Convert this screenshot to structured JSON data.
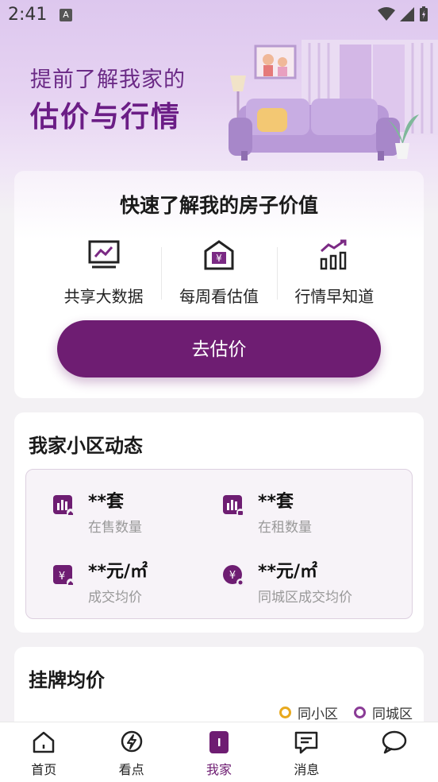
{
  "status_bar": {
    "time": "2:41",
    "badge": "A"
  },
  "hero": {
    "line1": "提前了解我家的",
    "line2": "估价与行情"
  },
  "valuation_card": {
    "title": "快速了解我的房子价值",
    "features": [
      {
        "icon": "chart-monitor-icon",
        "label": "共享大数据"
      },
      {
        "icon": "price-tag-icon",
        "label": "每周看估值"
      },
      {
        "icon": "trend-bars-icon",
        "label": "行情早知道"
      }
    ],
    "cta_label": "去估价"
  },
  "community_card": {
    "title": "我家小区动态",
    "stats": [
      {
        "value": "**套",
        "label": "在售数量",
        "icon": "for-sale-icon"
      },
      {
        "value": "**套",
        "label": "在租数量",
        "icon": "for-rent-icon"
      },
      {
        "value": "**元/㎡",
        "label": "成交均价",
        "icon": "deal-price-icon"
      },
      {
        "value": "**元/㎡",
        "label": "同城区成交均价",
        "icon": "district-price-icon"
      }
    ]
  },
  "listing_card": {
    "title": "挂牌均价",
    "legend": [
      {
        "label": "同小区",
        "color": "#e8a91e"
      },
      {
        "label": "同城区",
        "color": "#8a3b96"
      }
    ]
  },
  "bottom_nav": {
    "items": [
      {
        "label": "首页",
        "icon": "home-icon"
      },
      {
        "label": "看点",
        "icon": "lightning-icon"
      },
      {
        "label": "我家",
        "icon": "my-home-icon",
        "active": true
      },
      {
        "label": "消息",
        "icon": "message-icon"
      },
      {
        "label": "",
        "icon": "chat-bubble-icon"
      }
    ]
  },
  "colors": {
    "brand": "#6e1d72",
    "accent_yellow": "#e8a91e",
    "accent_purple": "#8a3b96"
  }
}
